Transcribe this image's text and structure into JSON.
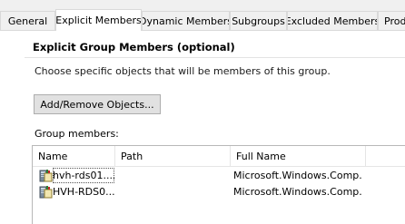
{
  "tabs": [
    {
      "label": "General"
    },
    {
      "label": "Explicit Members"
    },
    {
      "label": "Dynamic Members"
    },
    {
      "label": "Subgroups"
    },
    {
      "label": "Excluded Members"
    },
    {
      "label": "Prod"
    }
  ],
  "section": {
    "title": "Explicit Group Members (optional)",
    "description": "Choose specific objects that will be members of this group."
  },
  "add_remove_button": "Add/Remove Objects...",
  "members": {
    "label": "Group members:",
    "columns": [
      "Name",
      "Path",
      "Full Name"
    ],
    "rows": [
      {
        "name": "hvh-rds01....",
        "path": "",
        "full_name": "Microsoft.Windows.Comp..."
      },
      {
        "name": "HVH-RDS0...",
        "path": "",
        "full_name": "Microsoft.Windows.Comp..."
      }
    ]
  },
  "icon_names": [
    "computer-object-icon"
  ]
}
